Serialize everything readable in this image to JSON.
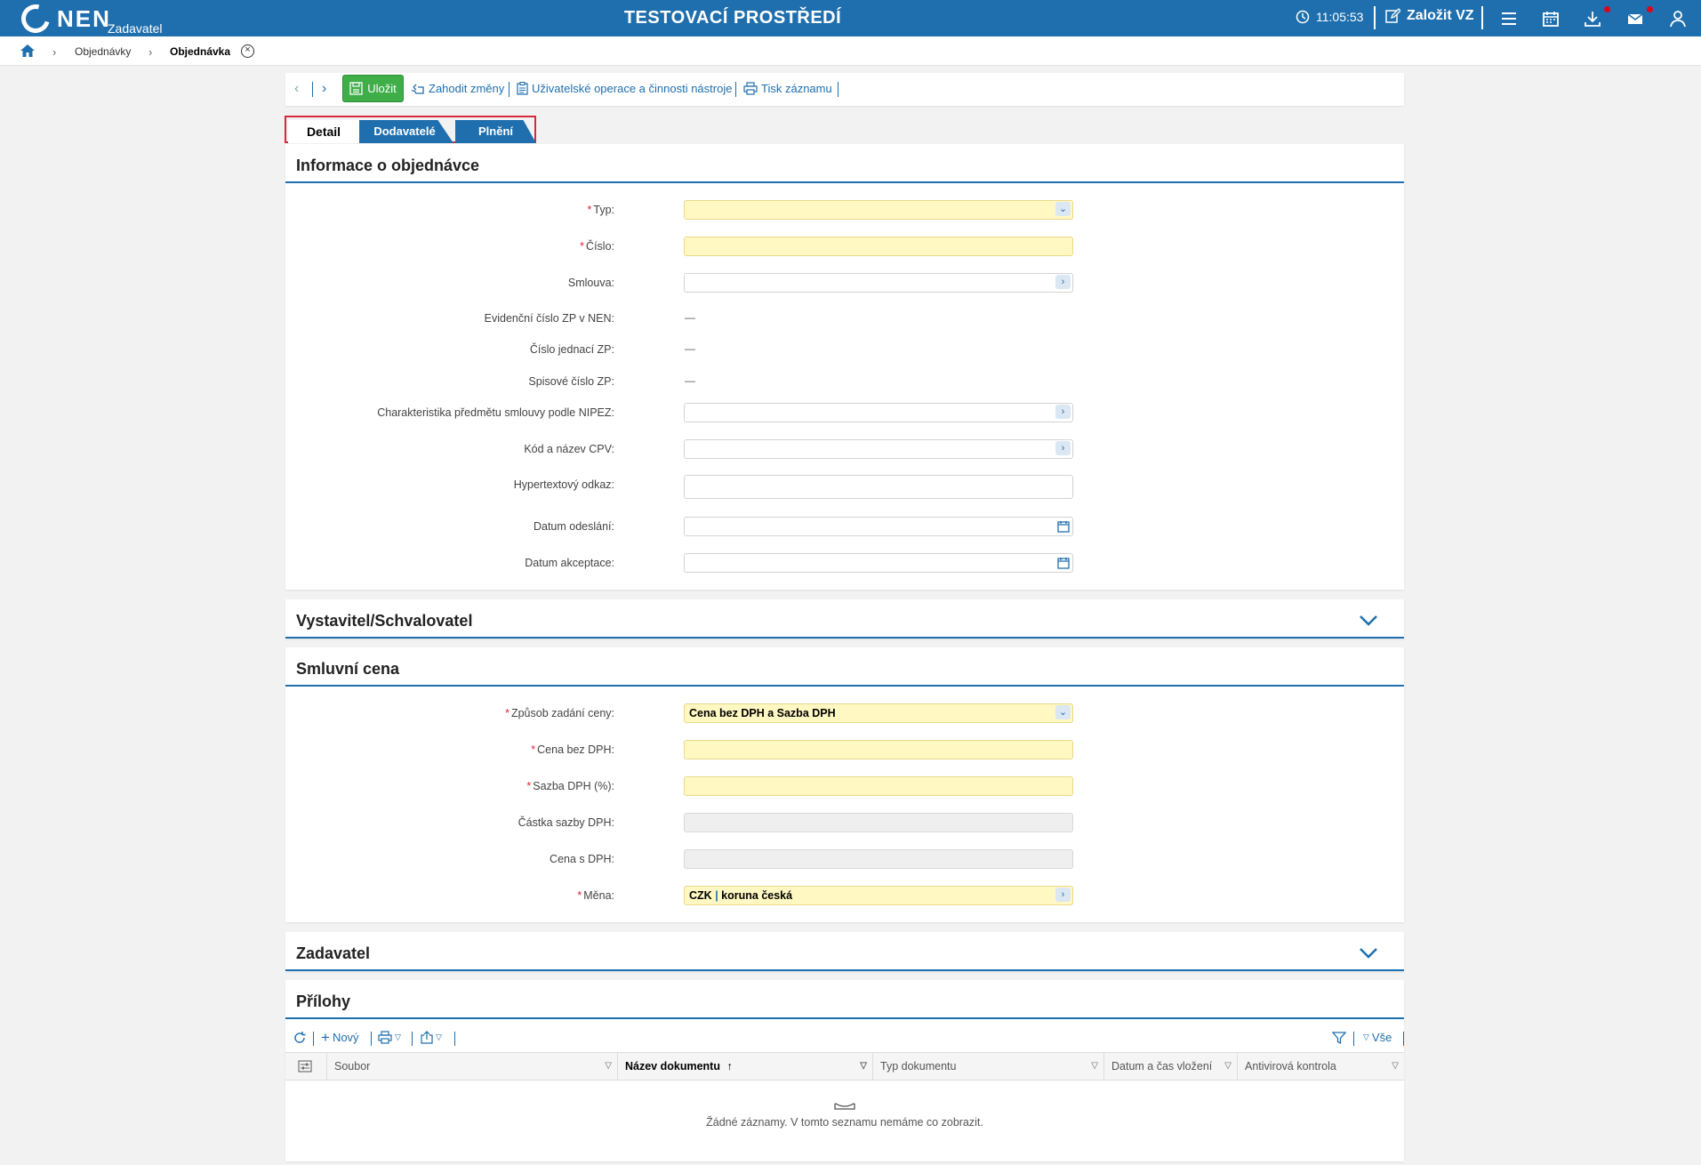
{
  "topbar": {
    "logo": "NEN",
    "logo_sub": "Zadavatel",
    "env_title": "TESTOVACÍ PROSTŘEDÍ",
    "clock": "11:05:53",
    "zalozit": "Založit VZ",
    "icons": [
      "clock-icon",
      "edit-icon",
      "menu-icon",
      "calendar-icon",
      "download-icon",
      "mail-icon",
      "user-icon"
    ],
    "notification_color": "#e1001a",
    "brand_color": "#1f6fae"
  },
  "breadcrumb": {
    "items": [
      "Objednávky",
      "Objednávka"
    ],
    "close": "×"
  },
  "toolbar": {
    "save": "Uložit",
    "discard": "Zahodit změny",
    "user_ops": "Uživatelské operace a činnosti nástroje",
    "print": "Tisk záznamu"
  },
  "tabs": [
    {
      "label": "Detail",
      "active": true
    },
    {
      "label": "Dodavatelé",
      "active": false
    },
    {
      "label": "Plnění",
      "active": false
    }
  ],
  "info_section": {
    "title": "Informace o objednávce",
    "fields": {
      "typ": {
        "label": "Typ:",
        "value": ""
      },
      "cislo": {
        "label": "Číslo:",
        "value": ""
      },
      "smlouva": {
        "label": "Smlouva:",
        "value": ""
      },
      "evidencni": {
        "label": "Evidenční číslo ZP v NEN:",
        "value": "—"
      },
      "jednaci": {
        "label": "Číslo jednací ZP:",
        "value": "—"
      },
      "spisove": {
        "label": "Spisové číslo ZP:",
        "value": "—"
      },
      "nipez": {
        "label": "Charakteristika předmětu smlouvy podle NIPEZ:",
        "value": ""
      },
      "cpv": {
        "label": "Kód a název CPV:",
        "value": ""
      },
      "odkaz": {
        "label": "Hypertextový odkaz:",
        "value": ""
      },
      "odeslani": {
        "label": "Datum odeslání:",
        "value": ""
      },
      "akceptace": {
        "label": "Datum akceptace:",
        "value": ""
      }
    }
  },
  "vystavitel_section": {
    "title": "Vystavitel/Schvalovatel"
  },
  "cena_section": {
    "title": "Smluvní cena",
    "fields": {
      "zpusob": {
        "label": "Způsob zadání ceny:",
        "value": "Cena bez DPH a Sazba DPH"
      },
      "bez_dph": {
        "label": "Cena bez DPH:",
        "value": ""
      },
      "sazba": {
        "label": "Sazba DPH (%):",
        "value": ""
      },
      "castka": {
        "label": "Částka sazby DPH:",
        "value": ""
      },
      "s_dph": {
        "label": "Cena s DPH:",
        "value": ""
      },
      "mena": {
        "label": "Měna:",
        "code": "CZK",
        "sep": "|",
        "name": "koruna česká"
      }
    }
  },
  "zadavatel_section": {
    "title": "Zadavatel"
  },
  "prilohy_section": {
    "title": "Přílohy",
    "toolbar": {
      "new": "Nový",
      "all": "Vše"
    },
    "columns": [
      "Soubor",
      "Název dokumentu",
      "Typ dokumentu",
      "Datum a čas vložení",
      "Antivirová kontrola"
    ],
    "sorted_column": "Název dokumentu",
    "empty_text": "Žádné záznamy. V tomto seznamu nemáme co zobrazit."
  }
}
